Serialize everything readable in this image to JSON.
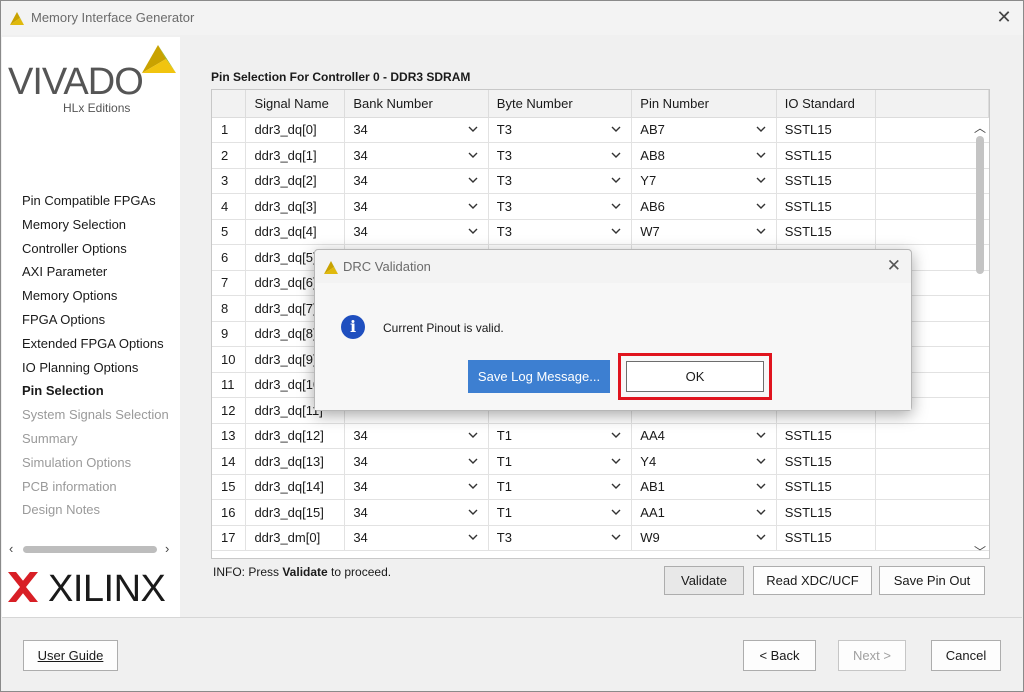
{
  "window": {
    "title": "Memory Interface Generator"
  },
  "sidebar": {
    "vivado_logo_text": "VIVADO",
    "vivado_sub_text": "HLx Editions",
    "steps": [
      {
        "label": "Pin Compatible FPGAs",
        "state": "normal"
      },
      {
        "label": "Memory Selection",
        "state": "normal"
      },
      {
        "label": "Controller Options",
        "state": "normal"
      },
      {
        "label": "AXI Parameter",
        "state": "normal"
      },
      {
        "label": "Memory Options",
        "state": "normal"
      },
      {
        "label": "FPGA Options",
        "state": "normal"
      },
      {
        "label": "Extended FPGA Options",
        "state": "normal"
      },
      {
        "label": "IO Planning Options",
        "state": "normal"
      },
      {
        "label": "Pin Selection",
        "state": "active"
      },
      {
        "label": "System Signals Selection",
        "state": "disabled"
      },
      {
        "label": "Summary",
        "state": "disabled"
      },
      {
        "label": "Simulation Options",
        "state": "disabled"
      },
      {
        "label": "PCB information",
        "state": "disabled"
      },
      {
        "label": "Design Notes",
        "state": "disabled"
      }
    ],
    "xilinx_logo_text": "XILINX"
  },
  "main": {
    "section_title": "Pin Selection For Controller 0 - DDR3 SDRAM",
    "columns": [
      "",
      "Signal Name",
      "Bank Number",
      "Byte Number",
      "Pin Number",
      "IO Standard"
    ],
    "rows": [
      [
        "1",
        "ddr3_dq[0]",
        "34",
        "T3",
        "AB7",
        "SSTL15"
      ],
      [
        "2",
        "ddr3_dq[1]",
        "34",
        "T3",
        "AB8",
        "SSTL15"
      ],
      [
        "3",
        "ddr3_dq[2]",
        "34",
        "T3",
        "Y7",
        "SSTL15"
      ],
      [
        "4",
        "ddr3_dq[3]",
        "34",
        "T3",
        "AB6",
        "SSTL15"
      ],
      [
        "5",
        "ddr3_dq[4]",
        "34",
        "T3",
        "W7",
        "SSTL15"
      ],
      [
        "6",
        "ddr3_dq[5]",
        "",
        "",
        "",
        ""
      ],
      [
        "7",
        "ddr3_dq[6]",
        "",
        "",
        "",
        ""
      ],
      [
        "8",
        "ddr3_dq[7]",
        "",
        "",
        "",
        ""
      ],
      [
        "9",
        "ddr3_dq[8]",
        "",
        "",
        "",
        ""
      ],
      [
        "10",
        "ddr3_dq[9]",
        "",
        "",
        "",
        ""
      ],
      [
        "11",
        "ddr3_dq[10",
        "",
        "",
        "",
        ""
      ],
      [
        "12",
        "ddr3_dq[11]",
        "",
        "",
        "",
        ""
      ],
      [
        "13",
        "ddr3_dq[12]",
        "34",
        "T1",
        "AA4",
        "SSTL15"
      ],
      [
        "14",
        "ddr3_dq[13]",
        "34",
        "T1",
        "Y4",
        "SSTL15"
      ],
      [
        "15",
        "ddr3_dq[14]",
        "34",
        "T1",
        "AB1",
        "SSTL15"
      ],
      [
        "16",
        "ddr3_dq[15]",
        "34",
        "T1",
        "AA1",
        "SSTL15"
      ],
      [
        "17",
        "ddr3_dm[0]",
        "34",
        "T3",
        "W9",
        "SSTL15"
      ]
    ],
    "info_prefix": "INFO: Press ",
    "info_bold": "Validate",
    "info_suffix": " to proceed.",
    "validate_label": "Validate",
    "read_xdc_label": "Read XDC/UCF",
    "save_pin_out_label": "Save Pin Out"
  },
  "footer": {
    "user_guide_label": "User Guide",
    "back_label": "< Back",
    "next_label": "Next >",
    "cancel_label": "Cancel"
  },
  "dialog": {
    "title": "DRC Validation",
    "message": "Current Pinout is valid.",
    "save_log_label": "Save Log Message...",
    "ok_label": "OK",
    "info_icon_glyph": "i"
  },
  "colors": {
    "highlight_outline": "#e0141e",
    "primary_button": "#3d7fd1",
    "info_icon": "#1f4fbf"
  }
}
